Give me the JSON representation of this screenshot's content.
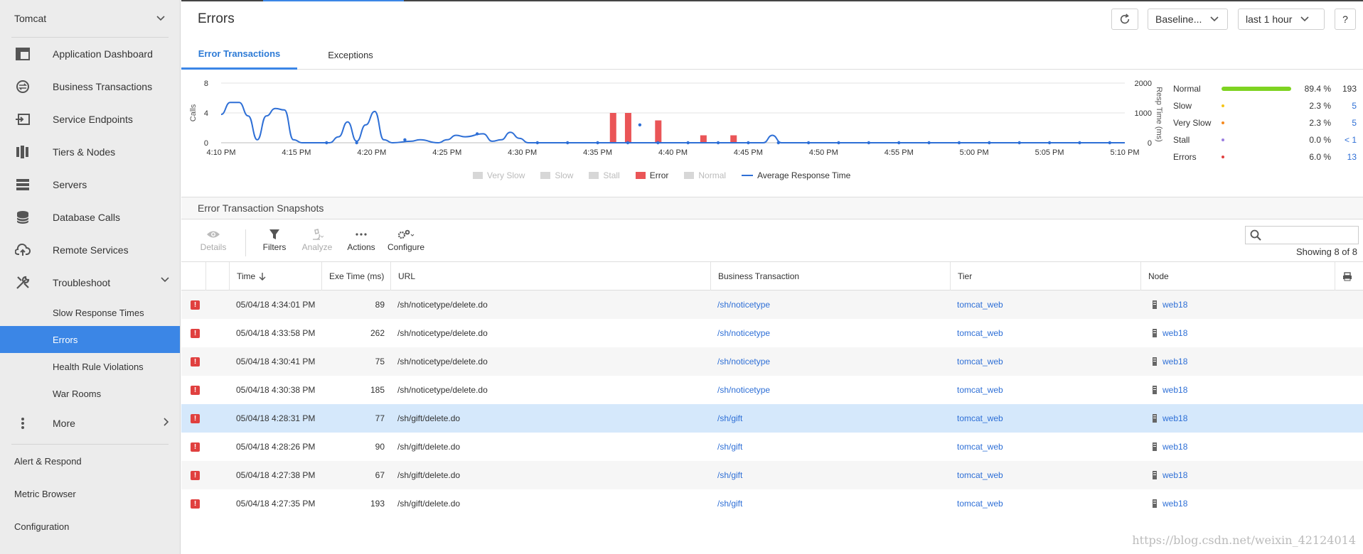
{
  "sidebar": {
    "app_name": "Tomcat",
    "items": [
      {
        "label": "Application Dashboard",
        "icon": "dashboard-icon"
      },
      {
        "label": "Business Transactions",
        "icon": "transactions-icon"
      },
      {
        "label": "Service Endpoints",
        "icon": "endpoint-icon"
      },
      {
        "label": "Tiers & Nodes",
        "icon": "tiers-icon"
      },
      {
        "label": "Servers",
        "icon": "server-icon"
      },
      {
        "label": "Database Calls",
        "icon": "database-icon"
      },
      {
        "label": "Remote Services",
        "icon": "cloud-upload-icon"
      },
      {
        "label": "Troubleshoot",
        "icon": "tools-icon"
      }
    ],
    "sub_items": [
      "Slow Response Times",
      "Errors",
      "Health Rule Violations",
      "War Rooms"
    ],
    "active_sub": "Errors",
    "more_label": "More",
    "bottom_items": [
      "Alert & Respond",
      "Metric Browser",
      "Configuration"
    ]
  },
  "header": {
    "title": "Errors",
    "baseline_label": "Baseline...",
    "range_label": "last 1 hour",
    "help_label": "?"
  },
  "tabs": [
    {
      "label": "Error Transactions",
      "active": true
    },
    {
      "label": "Exceptions",
      "active": false
    }
  ],
  "chart_data": {
    "type": "bar",
    "x": [
      "4:10 PM",
      "4:15 PM",
      "4:20 PM",
      "4:25 PM",
      "4:30 PM",
      "4:35 PM",
      "4:40 PM",
      "4:45 PM",
      "4:50 PM",
      "4:55 PM",
      "5:00 PM",
      "5:05 PM",
      "5:10 PM"
    ],
    "ylabel": "Calls",
    "y2label": "Resp Time (ms)",
    "ylim": [
      0,
      8
    ],
    "y2lim": [
      0,
      2000
    ],
    "yticks": [
      "0",
      "4",
      "8"
    ],
    "y2ticks": [
      "0",
      "1000",
      "2000"
    ],
    "series": [
      {
        "name": "Error",
        "type": "bar",
        "x_minutes": [
          26,
          27,
          29,
          32,
          34
        ],
        "values": [
          4,
          4,
          3,
          1,
          1
        ]
      },
      {
        "name": "Average Response Time",
        "type": "line",
        "points": [
          [
            0,
            950
          ],
          [
            1,
            1350
          ],
          [
            2,
            1350
          ],
          [
            3,
            900
          ],
          [
            4,
            100
          ],
          [
            5,
            900
          ],
          [
            6,
            1150
          ],
          [
            7,
            1100
          ],
          [
            8,
            100
          ],
          [
            9,
            0
          ],
          [
            12,
            0
          ],
          [
            13,
            200
          ],
          [
            14,
            700
          ],
          [
            15,
            50
          ],
          [
            16,
            600
          ],
          [
            17,
            1050
          ],
          [
            18,
            100
          ],
          [
            19,
            0
          ],
          [
            21,
            50
          ],
          [
            22,
            100
          ],
          [
            24,
            0
          ],
          [
            25,
            100
          ],
          [
            26,
            250
          ],
          [
            27,
            200
          ],
          [
            29,
            300
          ],
          [
            30,
            50
          ],
          [
            31,
            100
          ],
          [
            32,
            350
          ],
          [
            33,
            150
          ],
          [
            34,
            0
          ],
          [
            60,
            0
          ],
          [
            61,
            250
          ],
          [
            62,
            0
          ],
          [
            100,
            0
          ]
        ]
      }
    ],
    "legend": [
      "Very Slow",
      "Slow",
      "Stall",
      "Error",
      "Normal",
      "Average Response Time"
    ],
    "grid": true
  },
  "stats": [
    {
      "name": "Normal",
      "pct": "89.4 %",
      "count": "193",
      "color": "#7ed321",
      "fill": 0.894
    },
    {
      "name": "Slow",
      "pct": "2.3 %",
      "count": "5",
      "color": "#f5c518",
      "fill": 0
    },
    {
      "name": "Very Slow",
      "pct": "2.3 %",
      "count": "5",
      "color": "#f5891f",
      "fill": 0
    },
    {
      "name": "Stall",
      "pct": "0.0 %",
      "count": "< 1",
      "color": "#9b7ee0",
      "fill": 0
    },
    {
      "name": "Errors",
      "pct": "6.0 %",
      "count": "13",
      "color": "#e0403f",
      "fill": 0
    }
  ],
  "snapshots": {
    "title": "Error Transaction Snapshots",
    "toolbar": {
      "details": "Details",
      "filters": "Filters",
      "analyze": "Analyze",
      "actions": "Actions",
      "configure": "Configure"
    },
    "showing": "Showing 8 of 8",
    "columns": [
      "Time",
      "Exe Time (ms)",
      "URL",
      "Business Transaction",
      "Tier",
      "Node"
    ],
    "rows": [
      {
        "time": "05/04/18 4:34:01 PM",
        "exe": "89",
        "url": "/sh/noticetype/delete.do",
        "bt": "/sh/noticetype",
        "tier": "tomcat_web",
        "node": "web18"
      },
      {
        "time": "05/04/18 4:33:58 PM",
        "exe": "262",
        "url": "/sh/noticetype/delete.do",
        "bt": "/sh/noticetype",
        "tier": "tomcat_web",
        "node": "web18"
      },
      {
        "time": "05/04/18 4:30:41 PM",
        "exe": "75",
        "url": "/sh/noticetype/delete.do",
        "bt": "/sh/noticetype",
        "tier": "tomcat_web",
        "node": "web18"
      },
      {
        "time": "05/04/18 4:30:38 PM",
        "exe": "185",
        "url": "/sh/noticetype/delete.do",
        "bt": "/sh/noticetype",
        "tier": "tomcat_web",
        "node": "web18"
      },
      {
        "time": "05/04/18 4:28:31 PM",
        "exe": "77",
        "url": "/sh/gift/delete.do",
        "bt": "/sh/gift",
        "tier": "tomcat_web",
        "node": "web18"
      },
      {
        "time": "05/04/18 4:28:26 PM",
        "exe": "90",
        "url": "/sh/gift/delete.do",
        "bt": "/sh/gift",
        "tier": "tomcat_web",
        "node": "web18"
      },
      {
        "time": "05/04/18 4:27:38 PM",
        "exe": "67",
        "url": "/sh/gift/delete.do",
        "bt": "/sh/gift",
        "tier": "tomcat_web",
        "node": "web18"
      },
      {
        "time": "05/04/18 4:27:35 PM",
        "exe": "193",
        "url": "/sh/gift/delete.do",
        "bt": "/sh/gift",
        "tier": "tomcat_web",
        "node": "web18"
      }
    ],
    "selected_row": 4
  },
  "watermark": "https://blog.csdn.net/weixin_42124014"
}
